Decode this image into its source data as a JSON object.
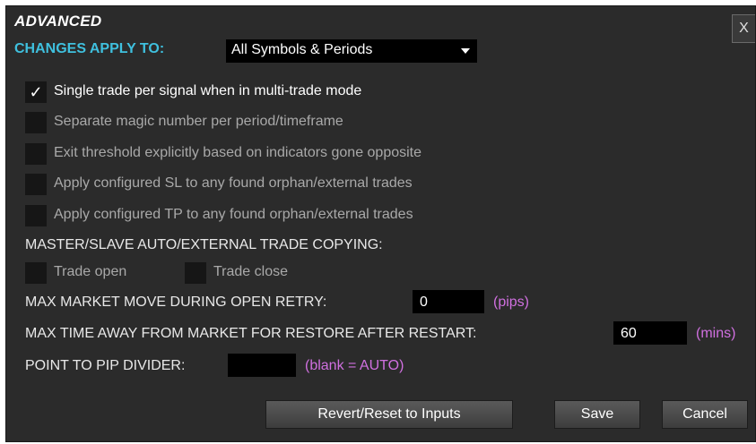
{
  "dialog": {
    "title": "ADVANCED",
    "close_label": "X"
  },
  "apply": {
    "label": "CHANGES APPLY TO:",
    "selected": "All Symbols & Periods"
  },
  "options": [
    {
      "label": "Single trade per signal when in multi-trade mode",
      "checked": true,
      "check_glyph": "✓"
    },
    {
      "label": "Separate magic number per period/timeframe",
      "checked": false
    },
    {
      "label": "Exit threshold explicitly based on indicators gone opposite",
      "checked": false
    },
    {
      "label": "Apply configured SL to any found orphan/external trades",
      "checked": false
    },
    {
      "label": "Apply configured TP to any found orphan/external trades",
      "checked": false
    }
  ],
  "copying": {
    "heading": "MASTER/SLAVE AUTO/EXTERNAL TRADE COPYING:",
    "trade_open": "Trade open",
    "trade_close": "Trade close"
  },
  "max_move": {
    "label": "MAX MARKET MOVE DURING OPEN RETRY:",
    "value": "0",
    "unit": "(pips)"
  },
  "max_time": {
    "label": "MAX TIME AWAY FROM MARKET FOR RESTORE AFTER RESTART:",
    "value": "60",
    "unit": "(mins)"
  },
  "pip_divider": {
    "label": "POINT TO PIP DIVIDER:",
    "value": "",
    "hint": "(blank = AUTO)"
  },
  "buttons": {
    "revert": "Revert/Reset to Inputs",
    "save": "Save",
    "cancel": "Cancel"
  },
  "colors": {
    "panel_bg": "#2b2b2b",
    "accent_cyan": "#3fc0de",
    "unit_magenta": "#d070e0"
  }
}
